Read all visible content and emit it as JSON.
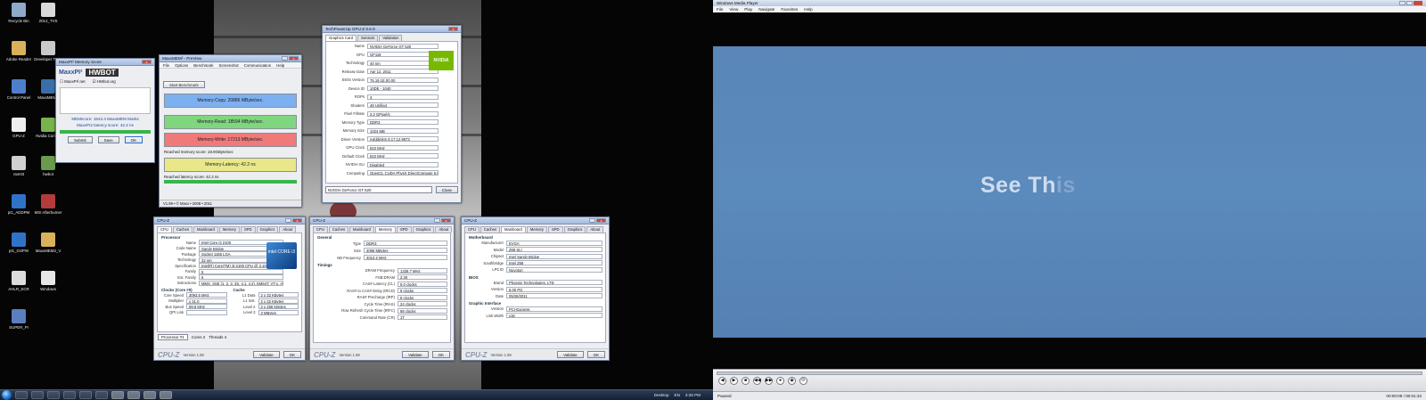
{
  "desktop": {
    "icons": [
      {
        "label": "Recycle Bin",
        "color": "#8fa9c9"
      },
      {
        "label": "2012_TVS",
        "color": "#d9d9d9"
      },
      {
        "label": "Adobe Reader",
        "color": "#d8b15a"
      },
      {
        "label": "Developer Tools",
        "color": "#c9c9c9"
      },
      {
        "label": "Control Panel",
        "color": "#4f7fcb"
      },
      {
        "label": "MaxxMEM2",
        "color": "#3a6ea8"
      },
      {
        "label": "GPU-Z",
        "color": "#eeeeee"
      },
      {
        "label": "Nvidia Control",
        "color": "#7ab24c"
      },
      {
        "label": "ram03",
        "color": "#d0d0d0"
      },
      {
        "label": "hwbot",
        "color": "#6a9a4c"
      },
      {
        "label": "pt1_ADDPM",
        "color": "#2f73c9"
      },
      {
        "label": "MSI Afterburner",
        "color": "#b53b3b"
      },
      {
        "label": "pt1_GSPW",
        "color": "#2f73c9"
      },
      {
        "label": "MaxxMEM2_V",
        "color": "#d8b15a"
      },
      {
        "label": "AHLR_SCR",
        "color": "#dcdcdc"
      },
      {
        "label": "Windows",
        "color": "#e6e6e6"
      },
      {
        "label": "SUPER_PI",
        "color": "#5a7fbf"
      }
    ]
  },
  "maxxmem_small": {
    "title": "MaxxPI² Memory Score",
    "brand": "MaxxPI²",
    "brand2": "HWBOT",
    "check1": "MaxxPI².net",
    "check2": "HWbot.org",
    "score_line": "MEMscore: 1543.4 MaxxMEM Marks",
    "latency_line": "MaxxPI2 latency score: 42.2 ns",
    "buttons": [
      "Submit",
      "Save",
      "OK"
    ]
  },
  "maxxmem_main": {
    "title": "MaxxMEM² - PreView",
    "menu": [
      "File",
      "Options",
      "Benchmark",
      "Screenshot",
      "Communication",
      "Help"
    ],
    "start_button": "Start Benchmark",
    "copy_label": "Memory-Copy: 20886 MByte/sec.",
    "read_label": "Memory-Read: 18594 MByte/sec.",
    "write_label": "Memory-Write: 17213 MByte/sec.",
    "latency_label": "Memory-Latency: 42.2 ns",
    "reached_bw": "Reached memory score: 18.9GByte/sec",
    "reached_lat": "Reached latency score: 42.2 ns",
    "status": "V1.99 • © Maxx • 2008 • 2011"
  },
  "gpuz": {
    "title": "TechPowerUp GPU-Z 0.6.9",
    "tabs": [
      "Graphics Card",
      "Sensors",
      "Validation"
    ],
    "rows": [
      {
        "k": "Name",
        "v": "NVIDIA GeForce GT 520"
      },
      {
        "k": "GPU",
        "v": "GF119"
      },
      {
        "k": "Technology",
        "v": "40 nm"
      },
      {
        "k": "Release Date",
        "v": "Apr 12, 2011"
      },
      {
        "k": "BIOS Version",
        "v": "75.19.1E.00.00"
      },
      {
        "k": "Device ID",
        "v": "10DE - 1040"
      },
      {
        "k": "ROPs",
        "v": "4"
      },
      {
        "k": "Shaders",
        "v": "48 Unified"
      },
      {
        "k": "Pixel Fillrate",
        "v": "3.2 GPixel/s"
      },
      {
        "k": "Memory Type",
        "v": "DDR3"
      },
      {
        "k": "Memory Size",
        "v": "1024 MB"
      },
      {
        "k": "Driver Version",
        "v": "nvlddmkm 8.17.12.9573"
      },
      {
        "k": "GPU Clock",
        "v": "810 MHz"
      },
      {
        "k": "Default Clock",
        "v": "810 MHz"
      },
      {
        "k": "NVIDIA SLI",
        "v": "Disabled"
      },
      {
        "k": "Computing",
        "v": "OpenCL  CUDA  PhysX  DirectCompute 5.0"
      }
    ],
    "selected_card": "NVIDIA GeForce GT 520",
    "close": "Close"
  },
  "cpuz_cpu": {
    "title": "CPU-Z",
    "tabs": [
      "CPU",
      "Caches",
      "Mainboard",
      "Memory",
      "SPD",
      "Graphics",
      "About"
    ],
    "group": "Processor",
    "rows": [
      {
        "k": "Name",
        "v": "Intel Core i3 2100"
      },
      {
        "k": "Code Name",
        "v": "Sandy Bridge"
      },
      {
        "k": "Package",
        "v": "Socket 1155 LGA"
      },
      {
        "k": "Technology",
        "v": "32 nm"
      },
      {
        "k": "Specification",
        "v": "Intel(R) Core(TM) i3-2100 CPU @ 3.10GHz"
      },
      {
        "k": "Family",
        "v": "6"
      },
      {
        "k": "Ext. Family",
        "v": "6"
      },
      {
        "k": "Instructions",
        "v": "MMX, SSE (1, 2, 3, 3S, 4.1, 4.2), EM64T, VT-x, AVX"
      }
    ],
    "clocks_group": "Clocks (Core #0)",
    "clocks": [
      {
        "k": "Core Speed",
        "v": "3093.5 MHz"
      },
      {
        "k": "Multiplier",
        "v": "x 31.0"
      },
      {
        "k": "Bus Speed",
        "v": "99.8 MHz"
      },
      {
        "k": "QPI Link",
        "v": ""
      }
    ],
    "cache_group": "Cache",
    "cache": [
      {
        "k": "L1 Data",
        "v": "2 x 32 KBytes"
      },
      {
        "k": "L1 Inst.",
        "v": "2 x 32 KBytes"
      },
      {
        "k": "Level 2",
        "v": "2 x 256 KBytes"
      },
      {
        "k": "Level 3",
        "v": "3 MBytes"
      }
    ],
    "selection": "Processor #1",
    "cores": "Cores 2",
    "threads": "Threads 4",
    "logo": "CPU-Z",
    "version": "Version 1.59",
    "validate": "Validate",
    "ok": "OK"
  },
  "cpuz_mem": {
    "title": "CPU-Z",
    "tabs": [
      "CPU",
      "Caches",
      "Mainboard",
      "Memory",
      "SPD",
      "Graphics",
      "About"
    ],
    "group": "General",
    "rows": [
      {
        "k": "Type",
        "v": "DDR3"
      },
      {
        "k": "Size",
        "v": "4096 MBytes"
      },
      {
        "k": "NB Frequency",
        "v": "4010.2 MHz"
      }
    ],
    "timings_group": "Timings",
    "timings": [
      {
        "k": "DRAM Frequency",
        "v": "1336.7 MHz"
      },
      {
        "k": "FSB:DRAM",
        "v": "2:40"
      },
      {
        "k": "CAS# Latency (CL)",
        "v": "9.0 clocks"
      },
      {
        "k": "RAS# to CAS# Delay (tRCD)",
        "v": "9 clocks"
      },
      {
        "k": "RAS# Precharge (tRP)",
        "v": "9 clocks"
      },
      {
        "k": "Cycle Time (tRAS)",
        "v": "24 clocks"
      },
      {
        "k": "Row Refresh Cycle Time (tRFC)",
        "v": "98 clocks"
      },
      {
        "k": "Command Rate (CR)",
        "v": "1T"
      }
    ],
    "logo": "CPU-Z",
    "version": "Version 1.59",
    "validate": "Validate",
    "ok": "OK"
  },
  "cpuz_mb": {
    "title": "CPU-Z",
    "tabs": [
      "CPU",
      "Caches",
      "Mainboard",
      "Memory",
      "SPD",
      "Graphics",
      "About"
    ],
    "group": "Motherboard",
    "rows": [
      {
        "k": "Manufacturer",
        "v": "EVGA"
      },
      {
        "k": "Model",
        "v": "Z68 SLI"
      },
      {
        "k": "Chipset",
        "v": "Intel Sandy Bridge"
      },
      {
        "k": "Southbridge",
        "v": "Intel Z68"
      },
      {
        "k": "LPCIO",
        "v": "Nuvoton"
      }
    ],
    "bios_group": "BIOS",
    "bios": [
      {
        "k": "Brand",
        "v": "Phoenix Technologies, LTD"
      },
      {
        "k": "Version",
        "v": "6.00 PG"
      },
      {
        "k": "Date",
        "v": "05/26/2011"
      }
    ],
    "gfx_group": "Graphic Interface",
    "gfx": [
      {
        "k": "Version",
        "v": "PCI-Express"
      },
      {
        "k": "Link Width",
        "v": "x16"
      }
    ],
    "logo": "CPU-Z",
    "version": "Version 1.59",
    "validate": "Validate",
    "ok": "OK"
  },
  "taskbar": {
    "tray": [
      "Desktop",
      "EN",
      "3:26 PM"
    ]
  },
  "player": {
    "title": "Windows Media Player",
    "menu": [
      "File",
      "View",
      "Play",
      "Navigate",
      "Favorites",
      "Help"
    ],
    "caption": "See Th",
    "caption_fade": "is",
    "status": "Paused",
    "time": "00:00:09 / 00:01:32",
    "controls": [
      "◀",
      "▶",
      "■",
      "◀◀",
      "▶▶",
      "●",
      "◉",
      "⟳"
    ]
  },
  "colors": {
    "copy_bar": "#7db0f0",
    "read_bar": "#7fd67f",
    "write_bar": "#f07a7a",
    "latency_bar": "#e8e88a",
    "video_bg": "#5a86b8"
  }
}
